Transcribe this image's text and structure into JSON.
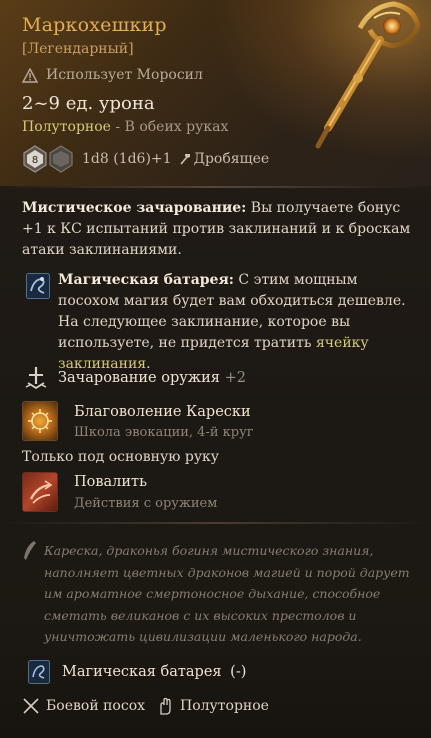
{
  "item": {
    "name": "Маркохешкир",
    "rarity": "[Легендарный]",
    "proficiency_warning": "Использует Моросил",
    "damage": "2~9 ед. урона",
    "hand_type": "Полуторное",
    "hand_desc": " - В обеих руках",
    "dice_main": "8",
    "dice_text": "1d8 (1d6)+1",
    "damage_type": "Дробящее"
  },
  "mystic": {
    "label": "Мистическое зачарование:",
    "text": " Вы получаете бонус +1 к КС испытаний против заклинаний и к броскам атаки заклинаниями."
  },
  "battery": {
    "label": "Магическая батарея:",
    "text": " С этим мощным посохом магия будет вам обходиться дешевле. На следующее заклинание, которое вы используете, не придется тратить ",
    "highlight": "ячейку заклинания",
    "end": "."
  },
  "enchant": {
    "label": "Зачарование оружия",
    "value": "+2"
  },
  "spell": {
    "title": "Благоволение Карески",
    "subtitle": "Школа эвокации, 4-й круг"
  },
  "main_hand_only": "Только под основную руку",
  "action": {
    "title": "Повалить",
    "subtitle": "Действия с оружием"
  },
  "lore": "Кареска, драконья богиня мистического знания, наполняет цветных драконов магией и порой дарует им ароматное смертоносное дыхание, способное сметать великанов с их высоких престолов и уничтожать цивилизации маленького народа.",
  "status": {
    "label": "Магическая батарея",
    "value": "(-)"
  },
  "tags": {
    "weapon": "Боевой посох",
    "hand": "Полуторное"
  }
}
